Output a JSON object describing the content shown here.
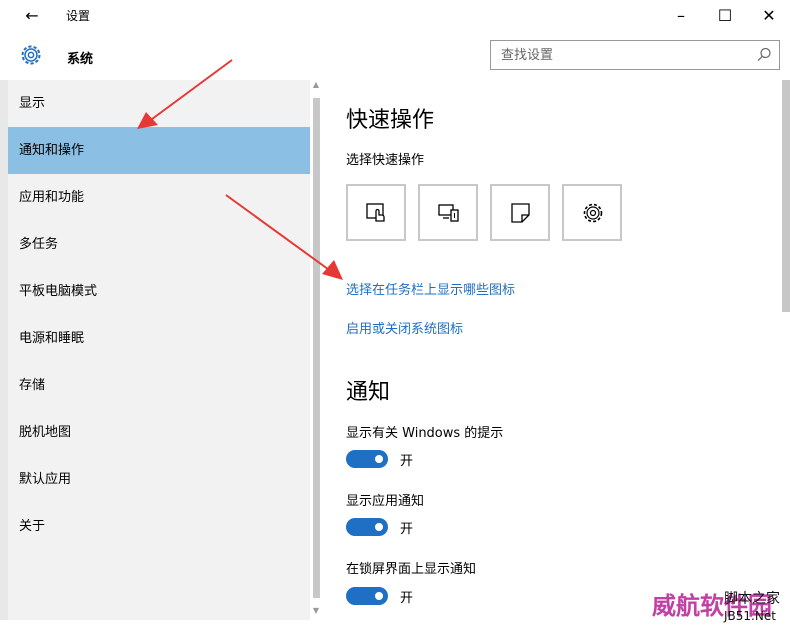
{
  "window": {
    "back_symbol": "←",
    "title": "设置",
    "minimize_symbol": "–",
    "maximize_symbol": "☐",
    "close_symbol": "✕"
  },
  "header": {
    "icon": "gear-icon",
    "title": "系统",
    "search_placeholder": "查找设置"
  },
  "sidebar": {
    "items": [
      {
        "label": "显示"
      },
      {
        "label": "通知和操作",
        "active": true
      },
      {
        "label": "应用和功能"
      },
      {
        "label": "多任务"
      },
      {
        "label": "平板电脑模式"
      },
      {
        "label": "电源和睡眠"
      },
      {
        "label": "存储"
      },
      {
        "label": "脱机地图"
      },
      {
        "label": "默认应用"
      },
      {
        "label": "关于"
      }
    ]
  },
  "main": {
    "quick_actions_title": "快速操作",
    "quick_actions_sub": "选择快速操作",
    "quick_actions": [
      {
        "icon": "tablet-mode-icon"
      },
      {
        "icon": "project-icon"
      },
      {
        "icon": "note-icon"
      },
      {
        "icon": "settings-gear-icon"
      }
    ],
    "link_taskbar_icons": "选择在任务栏上显示哪些图标",
    "link_system_icons": "启用或关闭系统图标",
    "notifications_title": "通知",
    "toggles": [
      {
        "label": "显示有关 Windows 的提示",
        "state": "开",
        "on": true
      },
      {
        "label": "显示应用通知",
        "state": "开",
        "on": true
      },
      {
        "label": "在锁屏界面上显示通知",
        "state": "开",
        "on": true
      }
    ]
  },
  "watermark": {
    "cn": "威航软件园",
    "site": "脚本之家",
    "domain": "JB51.Net"
  },
  "colors": {
    "accent": "#1f6fc4",
    "active_item": "#8cbfe4",
    "link": "#1f6fbf",
    "arrow": "#e53935"
  }
}
